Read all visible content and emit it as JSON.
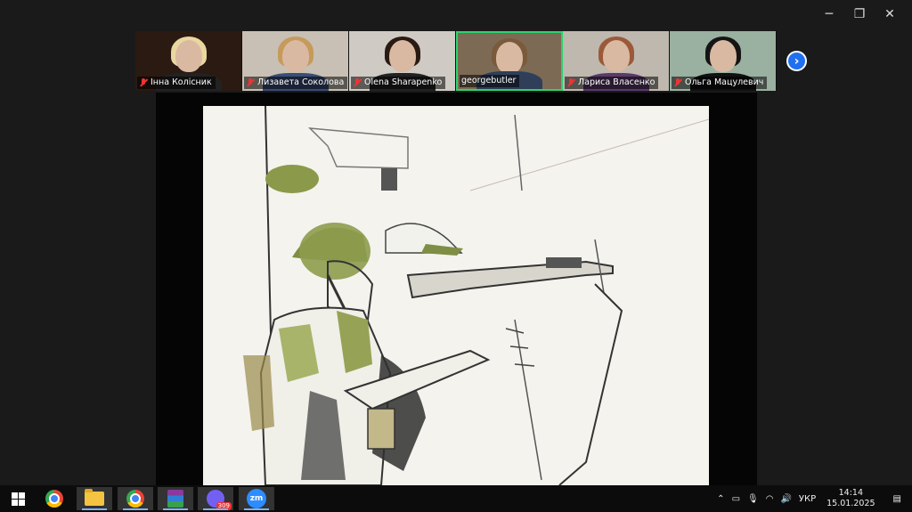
{
  "window": {
    "minimize_icon": "minimize-icon",
    "restore_icon": "restore-icon",
    "close_icon": "close-icon"
  },
  "participants": [
    {
      "name": "Інна Колісник",
      "muted": true,
      "hair": "#e9d7a0",
      "body": "#222",
      "bg": "#2a1a12"
    },
    {
      "name": "Лизавета Соколова",
      "muted": true,
      "hair": "#c69a5a",
      "body": "#3a4c78",
      "bg": "#c8c0b4"
    },
    {
      "name": "Olena Sharapenko",
      "muted": true,
      "hair": "#2a1a14",
      "body": "#222",
      "bg": "#cfcac4"
    },
    {
      "name": "georgebutler",
      "muted": false,
      "active": true,
      "hair": "#7a5a3a",
      "body": "#2f3f5a",
      "bg": "#7d6a55"
    },
    {
      "name": "Лариса Власенко",
      "muted": true,
      "hair": "#9a5a3a",
      "body": "#5a3a6a",
      "bg": "#bfb8ae"
    },
    {
      "name": "Ольга Мацулевич",
      "muted": true,
      "hair": "#151515",
      "body": "#111",
      "bg": "#9ab0a0"
    }
  ],
  "next_page_icon": "chevron-right-icon",
  "taskbar": {
    "apps": [
      {
        "name": "start-button",
        "icon": "windows-icon"
      },
      {
        "name": "chrome",
        "icon": "chrome-icon"
      },
      {
        "name": "file-explorer",
        "icon": "folder-icon"
      },
      {
        "name": "chrome-2",
        "icon": "chrome-icon"
      },
      {
        "name": "winrar",
        "icon": "winrar-icon"
      },
      {
        "name": "viber",
        "icon": "viber-icon",
        "badge": "309"
      },
      {
        "name": "zoom",
        "icon": "zoom-icon",
        "label": "zm"
      }
    ],
    "tray": {
      "language": "УКР",
      "time": "14:14",
      "date": "15.01.2025"
    }
  }
}
